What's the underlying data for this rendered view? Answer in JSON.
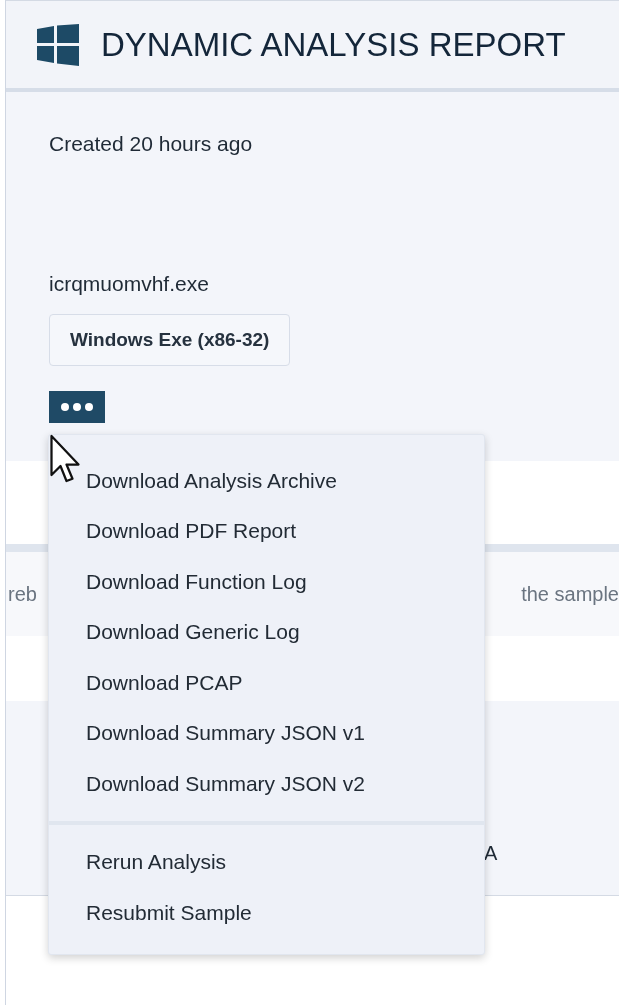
{
  "header": {
    "title": "DYNAMIC ANALYSIS REPORT"
  },
  "summary": {
    "created": "Created 20 hours ago",
    "filename": "icrqmuomvhf.exe",
    "file_type": "Windows Exe (x86-32)"
  },
  "background": {
    "row_1_left": "reb",
    "row_1_right": "the sample",
    "row_2_right": "A"
  },
  "menu": {
    "groups": [
      {
        "items": [
          "Download Analysis Archive",
          "Download PDF Report",
          "Download Function Log",
          "Download Generic Log",
          "Download PCAP",
          "Download Summary JSON v1",
          "Download Summary JSON v2"
        ]
      },
      {
        "items": [
          "Rerun Analysis",
          "Resubmit Sample"
        ]
      }
    ]
  }
}
